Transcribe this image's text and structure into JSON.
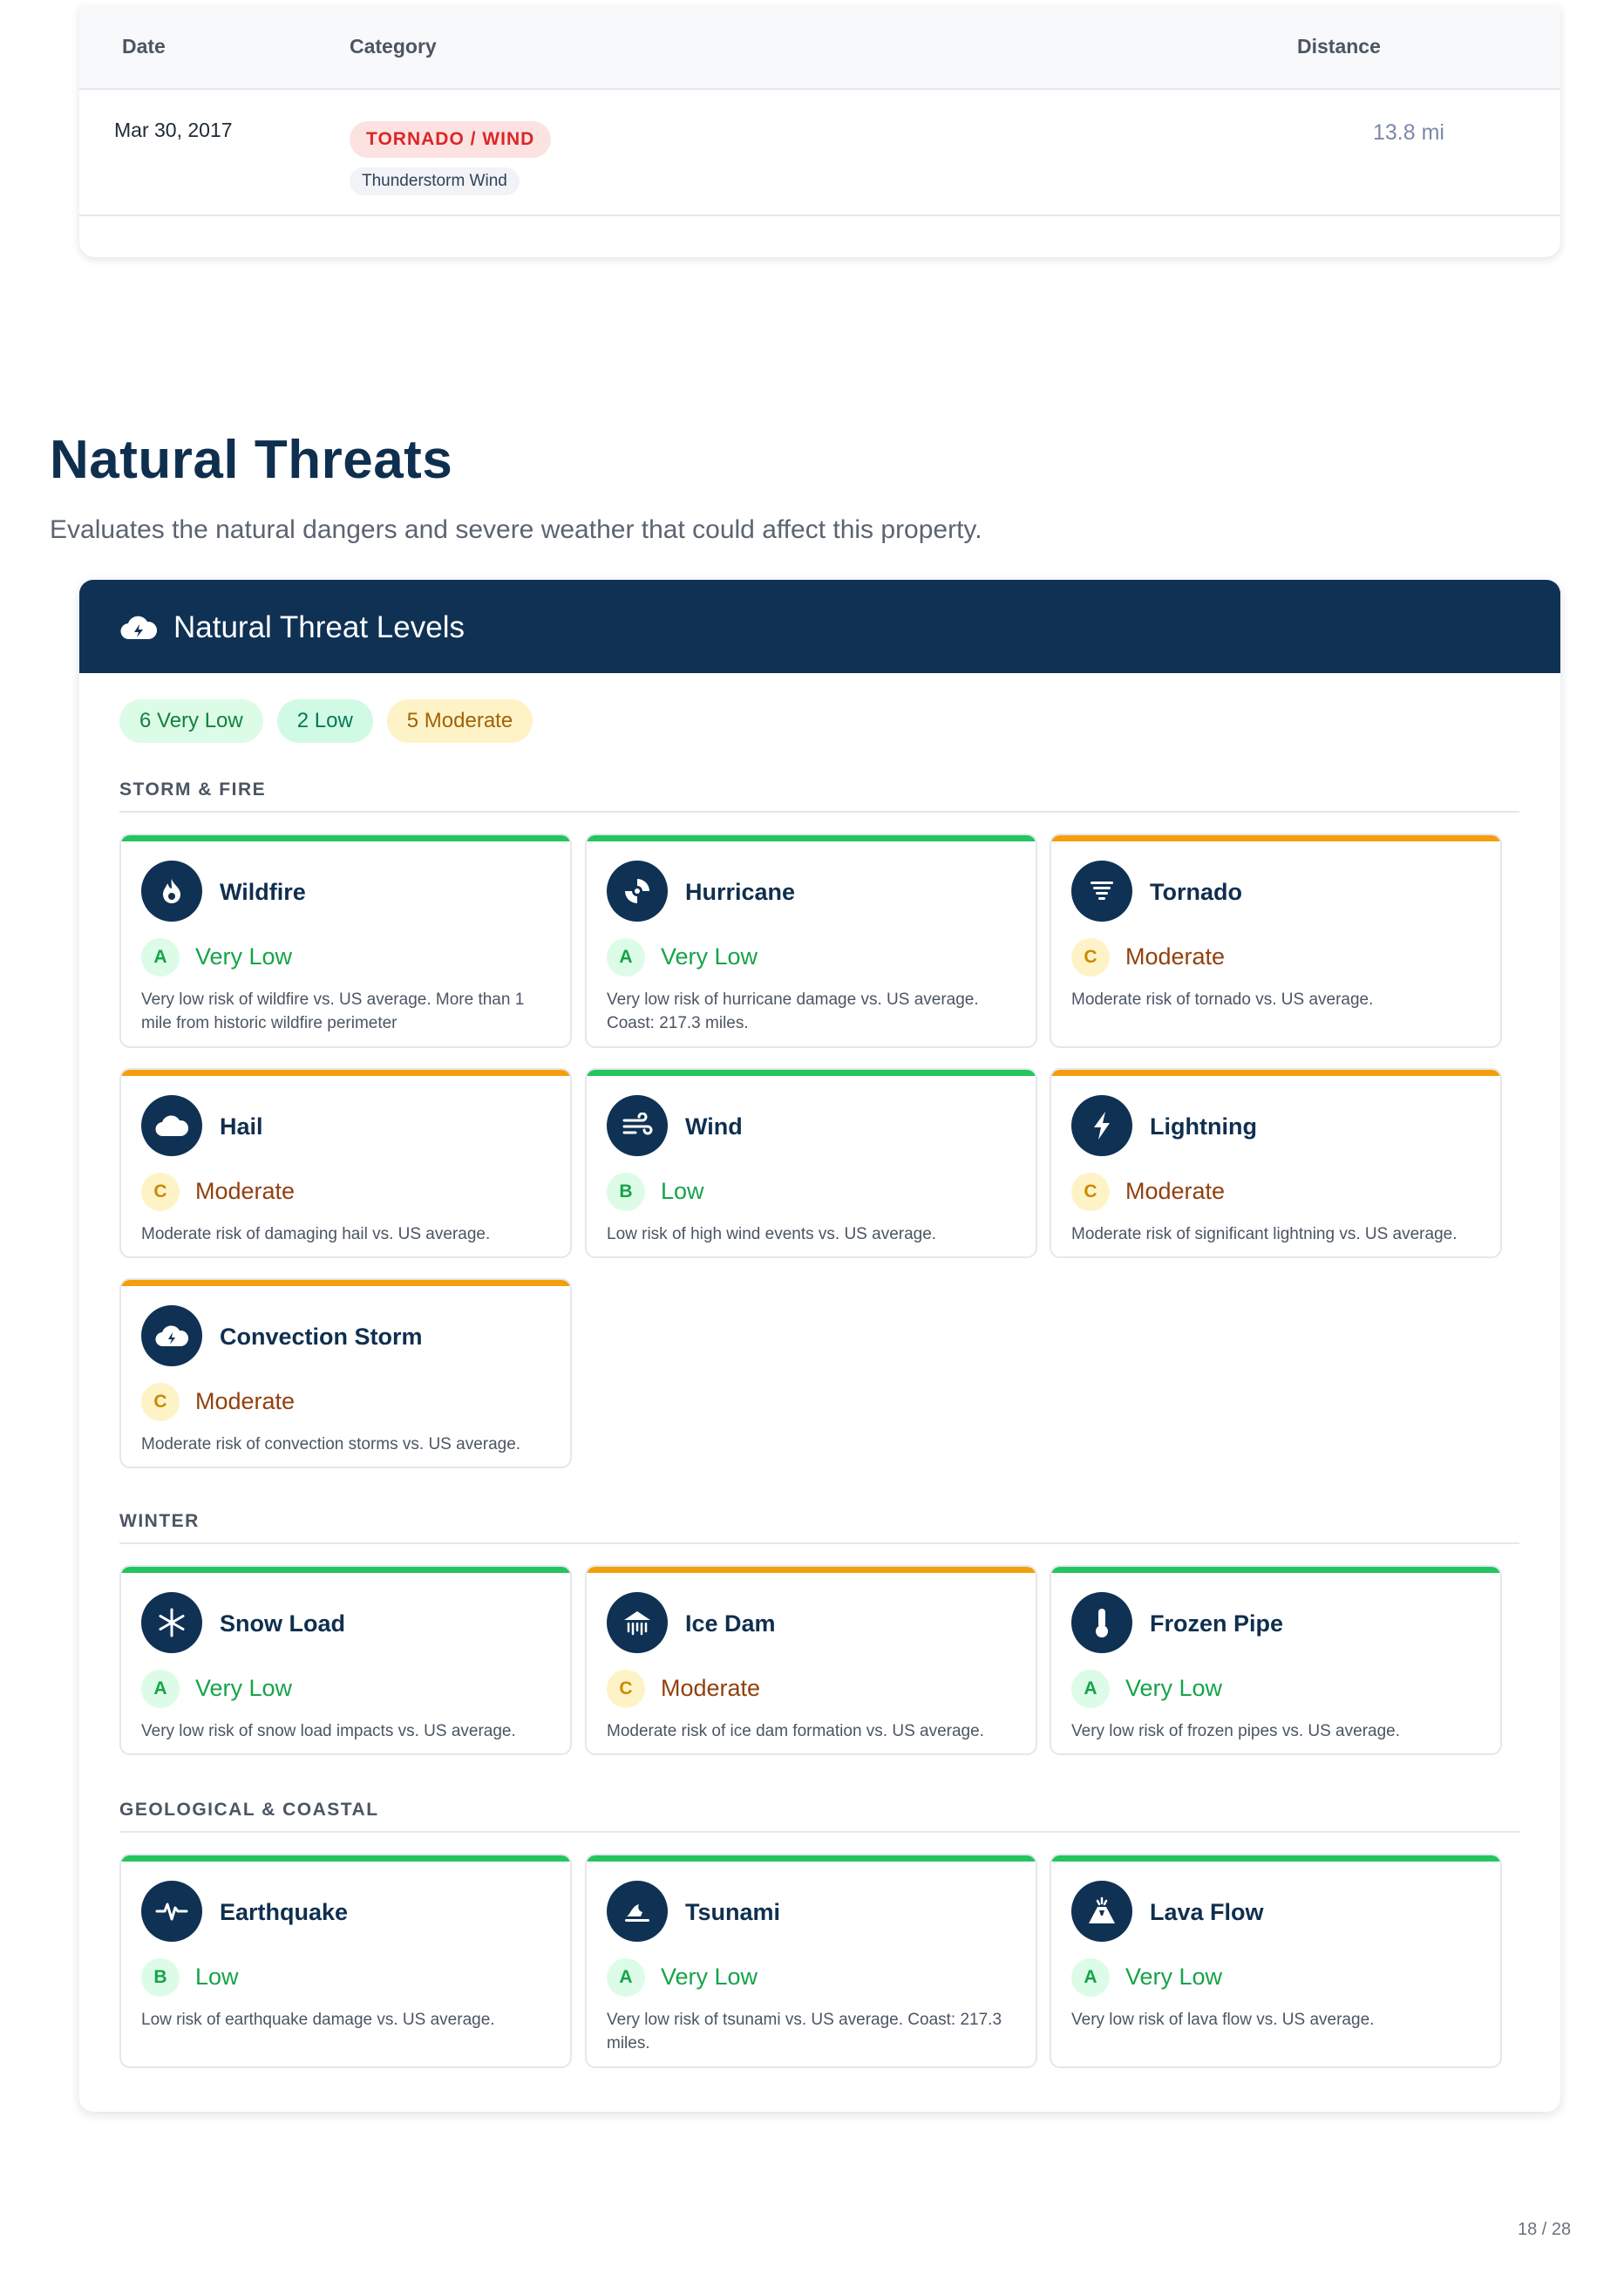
{
  "events_table": {
    "headers": {
      "date": "Date",
      "category": "Category",
      "distance": "Distance"
    },
    "rows": [
      {
        "date": "Mar 30, 2017",
        "category_tag": "TORNADO / WIND",
        "category_sub": "Thunderstorm Wind",
        "distance": "13.8 mi"
      }
    ]
  },
  "section": {
    "title": "Natural Threats",
    "description": "Evaluates the natural dangers and severe weather that could affect this property."
  },
  "card": {
    "title": "Natural Threat Levels",
    "header_icon": "cloud-bolt-icon",
    "summary": [
      "6 Very Low",
      "2 Low",
      "5 Moderate"
    ]
  },
  "groups": [
    {
      "label": "STORM & FIRE",
      "threats": [
        {
          "name": "Wildfire",
          "icon": "fire-icon",
          "grade": "A",
          "level": "Very Low",
          "desc": "Very low risk of wildfire vs. US average. More than 1 mile from historic wildfire perimeter"
        },
        {
          "name": "Hurricane",
          "icon": "hurricane-icon",
          "grade": "A",
          "level": "Very Low",
          "desc": "Very low risk of hurricane damage vs. US average. Coast: 217.3 miles."
        },
        {
          "name": "Tornado",
          "icon": "tornado-icon",
          "grade": "C",
          "level": "Moderate",
          "desc": "Moderate risk of tornado vs. US average."
        },
        {
          "name": "Hail",
          "icon": "cloud-icon",
          "grade": "C",
          "level": "Moderate",
          "desc": "Moderate risk of damaging hail vs. US average."
        },
        {
          "name": "Wind",
          "icon": "wind-icon",
          "grade": "B",
          "level": "Low",
          "desc": "Low risk of high wind events vs. US average."
        },
        {
          "name": "Lightning",
          "icon": "bolt-icon",
          "grade": "C",
          "level": "Moderate",
          "desc": "Moderate risk of significant lightning vs. US average."
        },
        {
          "name": "Convection Storm",
          "icon": "cloud-bolt-icon",
          "grade": "C",
          "level": "Moderate",
          "desc": "Moderate risk of convection storms vs. US average."
        }
      ]
    },
    {
      "label": "WINTER",
      "threats": [
        {
          "name": "Snow Load",
          "icon": "snowflake-icon",
          "grade": "A",
          "level": "Very Low",
          "desc": "Very low risk of snow load impacts vs. US average."
        },
        {
          "name": "Ice Dam",
          "icon": "house-icicles-icon",
          "grade": "C",
          "level": "Moderate",
          "desc": "Moderate risk of ice dam formation vs. US average."
        },
        {
          "name": "Frozen Pipe",
          "icon": "thermometer-icon",
          "grade": "A",
          "level": "Very Low",
          "desc": "Very low risk of frozen pipes vs. US average."
        }
      ]
    },
    {
      "label": "GEOLOGICAL & COASTAL",
      "threats": [
        {
          "name": "Earthquake",
          "icon": "heart-pulse-icon",
          "grade": "B",
          "level": "Low",
          "desc": "Low risk of earthquake damage vs. US average."
        },
        {
          "name": "Tsunami",
          "icon": "water-ladder-icon",
          "grade": "A",
          "level": "Very Low",
          "desc": "Very low risk of tsunami vs. US average. Coast: 217.3 miles."
        },
        {
          "name": "Lava Flow",
          "icon": "volcano-icon",
          "grade": "A",
          "level": "Very Low",
          "desc": "Very low risk of lava flow vs. US average."
        }
      ]
    }
  ],
  "colors": {
    "navy": "#0f3154",
    "good": "#22c55e",
    "moderate": "#f59e0b",
    "tag_red": "#dc2626"
  },
  "page_number": "18 / 28"
}
